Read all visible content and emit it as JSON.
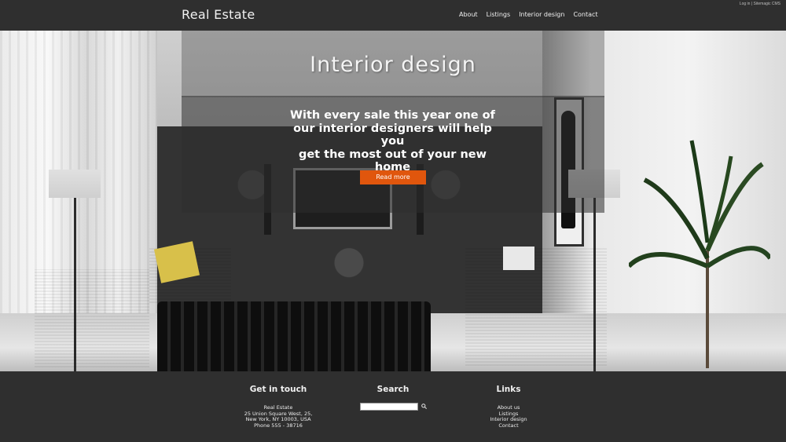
{
  "header": {
    "brand": "Real Estate",
    "top_links": {
      "login": "Log in",
      "separator": "|",
      "cms": "Sitemagic CMS"
    },
    "nav": [
      "About",
      "Listings",
      "Interior design",
      "Contact"
    ]
  },
  "hero": {
    "title": "Interior design",
    "subtitle_lines": [
      "With every sale this year one of",
      "our interior designers will help you",
      "get the most out of your new home"
    ],
    "button_label": "Read more"
  },
  "footer": {
    "contact": {
      "heading": "Get in touch",
      "lines": [
        "Real Estate",
        "25 Union Square West, 25,",
        "New York, NY 10003, USA",
        "Phone 555 - 38716"
      ]
    },
    "search": {
      "heading": "Search",
      "placeholder": ""
    },
    "links": {
      "heading": "Links",
      "items": [
        "About us",
        "Listings",
        "Interior design",
        "Contact"
      ]
    }
  },
  "colors": {
    "accent": "#e0560d",
    "header_bg": "#2f2f2f",
    "footer_bg": "#2f2f2f"
  },
  "icons": {
    "search": "magnifier-icon"
  }
}
